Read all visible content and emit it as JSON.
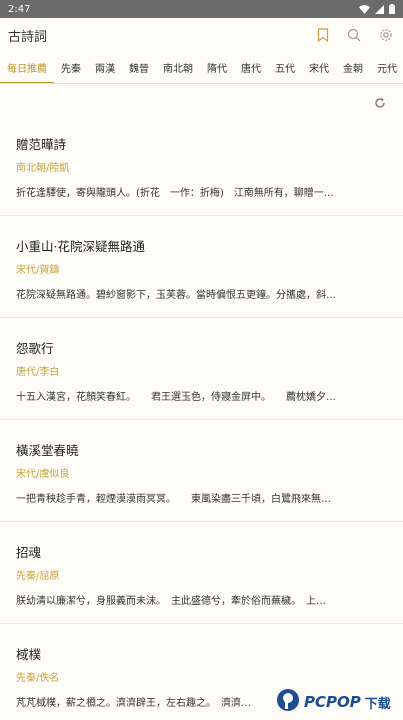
{
  "status": {
    "time": "2:47"
  },
  "app": {
    "title": "古詩詞"
  },
  "tabs": [
    {
      "label": "每日推薦"
    },
    {
      "label": "先秦"
    },
    {
      "label": "兩漢"
    },
    {
      "label": "魏晉"
    },
    {
      "label": "南北朝"
    },
    {
      "label": "隋代"
    },
    {
      "label": "唐代"
    },
    {
      "label": "五代"
    },
    {
      "label": "宋代"
    },
    {
      "label": "金朝"
    },
    {
      "label": "元代"
    }
  ],
  "poems": [
    {
      "title": "贈范曄詩",
      "author": "南北朝/陸凱",
      "excerpt": "折花逢驛使，寄與隴頭人。(折花　一作：折梅)　江南無所有，聊贈一…"
    },
    {
      "title": "小重山·花院深疑無路通",
      "author": "宋代/賀鑄",
      "excerpt": "花院深疑無路通。碧紗窗影下，玉芙蓉。當時偏恨五更鐘。分攜處，斜…"
    },
    {
      "title": "怨歌行",
      "author": "唐代/李白",
      "excerpt": "十五入漢宮，花顏笑春紅。　　君王選玉色，侍寢金屏中。　　薦枕嬌夕…"
    },
    {
      "title": "橫溪堂春曉",
      "author": "宋代/虞似良",
      "excerpt": "一把青秧趁手青，輕煙漠漠雨冥冥。　　東風染盡三千頃，白鷺飛來無…"
    },
    {
      "title": "招魂",
      "author": "先秦/屈原",
      "excerpt": "朕幼清以廉潔兮，身服義而未沫。　主此盛德兮，牽於俗而蕪穢。　上…"
    },
    {
      "title": "棫樸",
      "author": "先秦/佚名",
      "excerpt": "芃芃棫樸，薪之槱之。濟濟辟王，左右趣之。　濟濟…"
    }
  ],
  "watermark": {
    "brand": "PCPOP",
    "suffix": "下载"
  },
  "colors": {
    "accent": "#c9a43e",
    "background": "#fdfcf7"
  }
}
